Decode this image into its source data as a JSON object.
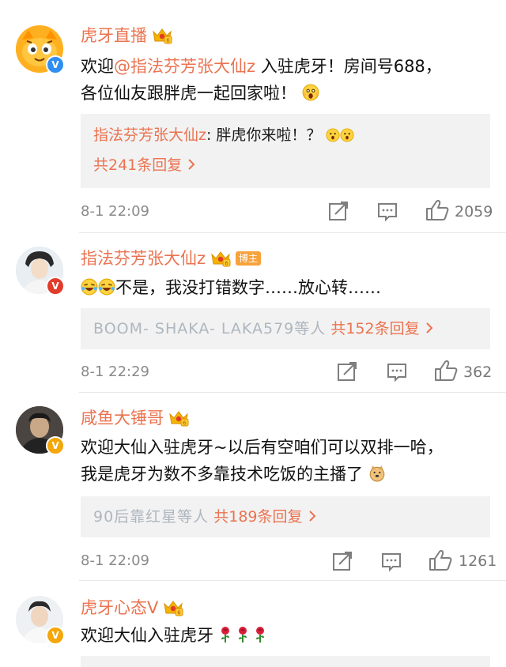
{
  "comments": [
    {
      "username": "虎牙直播",
      "text_pre": "欢迎",
      "mention": "@指法芬芳张大仙z",
      "text_post": " 入驻虎牙！房间号688，",
      "text_line2": "各位仙友跟胖虎一起回家啦！",
      "verified_icon": "blue-v",
      "reply_preview": {
        "author": "指法芬芳张大仙z",
        "text": ": 胖虎你来啦！？"
      },
      "reply_count_text": "共241条回复",
      "timestamp": "8-1 22:09",
      "likes": "2059"
    },
    {
      "username": "指法芬芳张大仙z",
      "badge": "博主",
      "text": "不是，我没打错数字……放心转……",
      "verified_icon": "red-v",
      "reply_faded": "BOOM- SHAKA- LAKA579等人",
      "reply_count_text": "共152条回复",
      "timestamp": "8-1 22:29",
      "likes": "362"
    },
    {
      "username": "咸鱼大锤哥",
      "text_line1": "欢迎大仙入驻虎牙~以后有空咱们可以双排一哈，",
      "text_line2": "我是虎牙为数不多靠技术吃饭的主播了",
      "verified_icon": "gold-v",
      "reply_faded": "90后靠红星等人",
      "reply_count_text": "共189条回复",
      "timestamp": "8-1 22:09",
      "likes": "1261"
    },
    {
      "username": "虎牙心态V",
      "text": "欢迎大仙入驻虎牙",
      "verified_icon": "gold-v"
    }
  ],
  "icons": {
    "share": "share-icon",
    "comment": "comment-icon",
    "like": "thumbs-up-icon",
    "chevron": "chevron-right-icon"
  },
  "colors": {
    "username": "#eb7350",
    "reply_bg": "#f2f2f2",
    "meta": "#8a8a8a"
  }
}
